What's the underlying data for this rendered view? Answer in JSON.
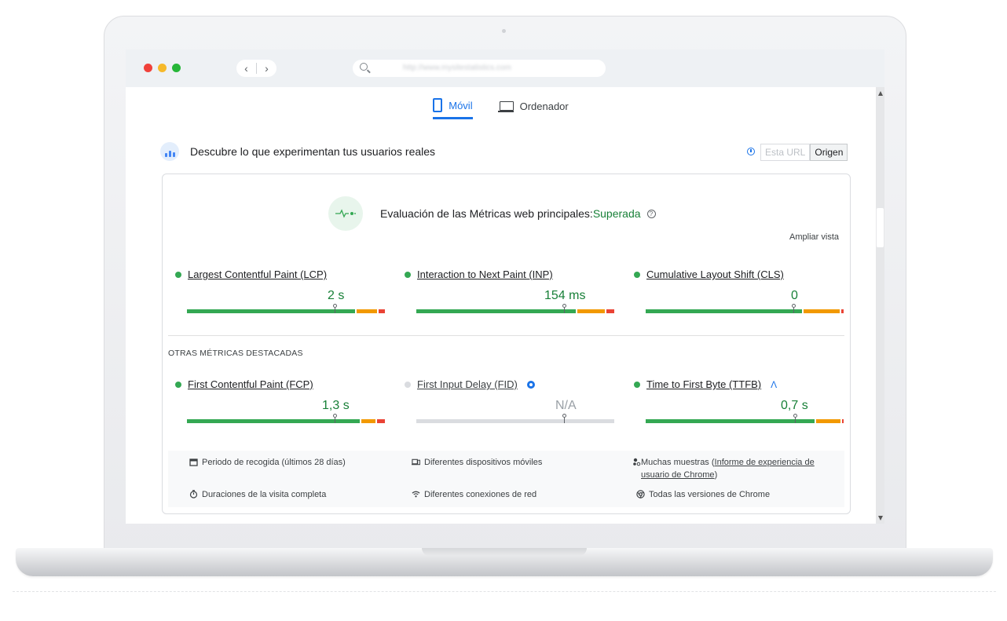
{
  "browser": {
    "url": "http://www.mysitestatistics.com"
  },
  "tabs": [
    {
      "label": "Móvil",
      "active": true
    },
    {
      "label": "Ordenador",
      "active": false
    }
  ],
  "header": {
    "title": "Descubre lo que experimentan tus usuarios reales",
    "toggle": [
      {
        "label": "Esta URL",
        "active": false
      },
      {
        "label": "Origen",
        "active": true
      }
    ]
  },
  "assessment": {
    "label": "Evaluación de las Métricas web principales:",
    "status": "Superada",
    "expand_label": "Ampliar vista"
  },
  "core_metrics": [
    {
      "name": "Largest Contentful Paint (LCP)",
      "value": "2 s",
      "status": "good"
    },
    {
      "name": "Interaction to Next Paint (INP)",
      "value": "154 ms",
      "status": "good"
    },
    {
      "name": "Cumulative Layout Shift (CLS)",
      "value": "0",
      "status": "good"
    }
  ],
  "other_section_title": "OTRAS MÉTRICAS DESTACADAS",
  "other_metrics": [
    {
      "name": "First Contentful Paint (FCP)",
      "value": "1,3 s",
      "status": "good"
    },
    {
      "name": "First Input Delay (FID)",
      "value": "N/A",
      "status": "none"
    },
    {
      "name": "Time to First Byte (TTFB)",
      "value": "0,7 s",
      "status": "good"
    }
  ],
  "footer": {
    "period": "Periodo de recogida (últimos 28 días)",
    "devices": "Diferentes dispositivos móviles",
    "samples_prefix": "Muchas muestras (",
    "samples_link": "Informe de experiencia de usuario de Chrome",
    "samples_suffix": ")",
    "duration": "Duraciones de la visita completa",
    "network": "Diferentes conexiones de red",
    "chrome": "Todas las versiones de Chrome"
  },
  "colors": {
    "good": "#34a853",
    "needs_improvement": "#f29900",
    "poor": "#ea4335",
    "accent": "#1a73e8"
  }
}
